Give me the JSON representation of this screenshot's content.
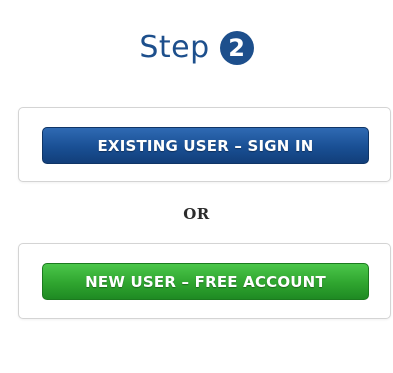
{
  "step": {
    "label": "Step",
    "number": "2"
  },
  "existing": {
    "button_label": "EXISTING USER  –  SIGN IN",
    "color": "#194f94"
  },
  "separator": {
    "label": "OR"
  },
  "new_user": {
    "button_label": "NEW USER  –  FREE ACCOUNT",
    "color": "#2fa52f"
  },
  "colors": {
    "heading": "#1d4f8c"
  }
}
